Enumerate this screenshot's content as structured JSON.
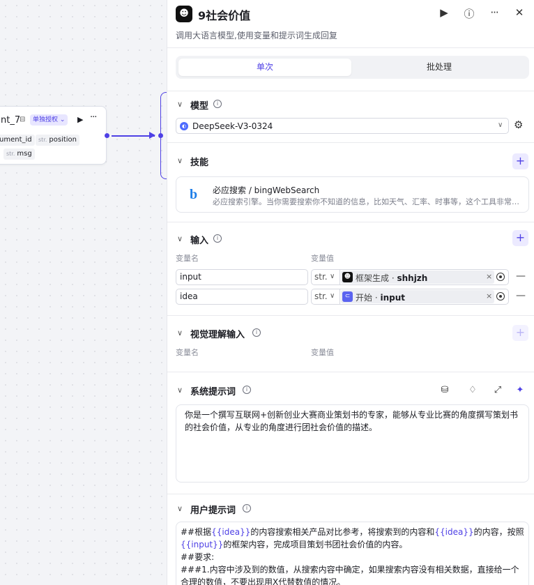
{
  "canvas": {
    "node": {
      "title": "nt_7",
      "badge": "单独授权",
      "vars": [
        {
          "type": "",
          "name": "ument_id"
        },
        {
          "type": "str.",
          "name": "position"
        },
        {
          "type": "str.",
          "name": "msg"
        }
      ]
    }
  },
  "header": {
    "title": "9社会价值",
    "description": "调用大语言模型,使用变量和提示词生成回复"
  },
  "tabs": [
    {
      "label": "单次",
      "active": true
    },
    {
      "label": "批处理",
      "active": false
    }
  ],
  "model": {
    "section_title": "模型",
    "selected": "DeepSeek-V3-0324"
  },
  "skills": {
    "section_title": "技能",
    "items": [
      {
        "name": "必应搜索 / bingWebSearch",
        "description": "必应搜索引擎。当你需要搜索你不知道的信息，比如天气、汇率、时事等，这个工具非常有用。"
      }
    ]
  },
  "inputs": {
    "section_title": "输入",
    "col_name": "变量名",
    "col_value": "变量值",
    "rows": [
      {
        "name": "input",
        "type": "str.",
        "ref_source": "框架生成",
        "ref_var": "shhjzh"
      },
      {
        "name": "idea",
        "type": "str.",
        "ref_source": "开始",
        "ref_var": "input"
      }
    ]
  },
  "vision": {
    "section_title": "视觉理解输入",
    "col_name": "变量名",
    "col_value": "变量值"
  },
  "system_prompt": {
    "section_title": "系统提示词",
    "text": "你是一个撰写互联网+创新创业大赛商业策划书的专家，能够从专业比赛的角度撰写策划书的社会价值，从专业的角度进行团社会价值的描述。"
  },
  "user_prompt": {
    "section_title": "用户提示词",
    "line1_a": "##根据",
    "line1_var1": "{{idea}}",
    "line1_b": "的内容搜索相关产品对比参考，将搜索到的内容和",
    "line1_var2": "{{idea}}",
    "line1_c": "的内容，按照",
    "line1_var3": "{{input}}",
    "line1_d": "的框架内容，完成项目策划书团社会价值的内容。",
    "line2": "##要求:",
    "line3": "###1.内容中涉及到的数值，从搜索内容中确定，如果搜索内容没有相关数据，直接给一个合理的数值，不要出现用X代替数值的情况。"
  }
}
